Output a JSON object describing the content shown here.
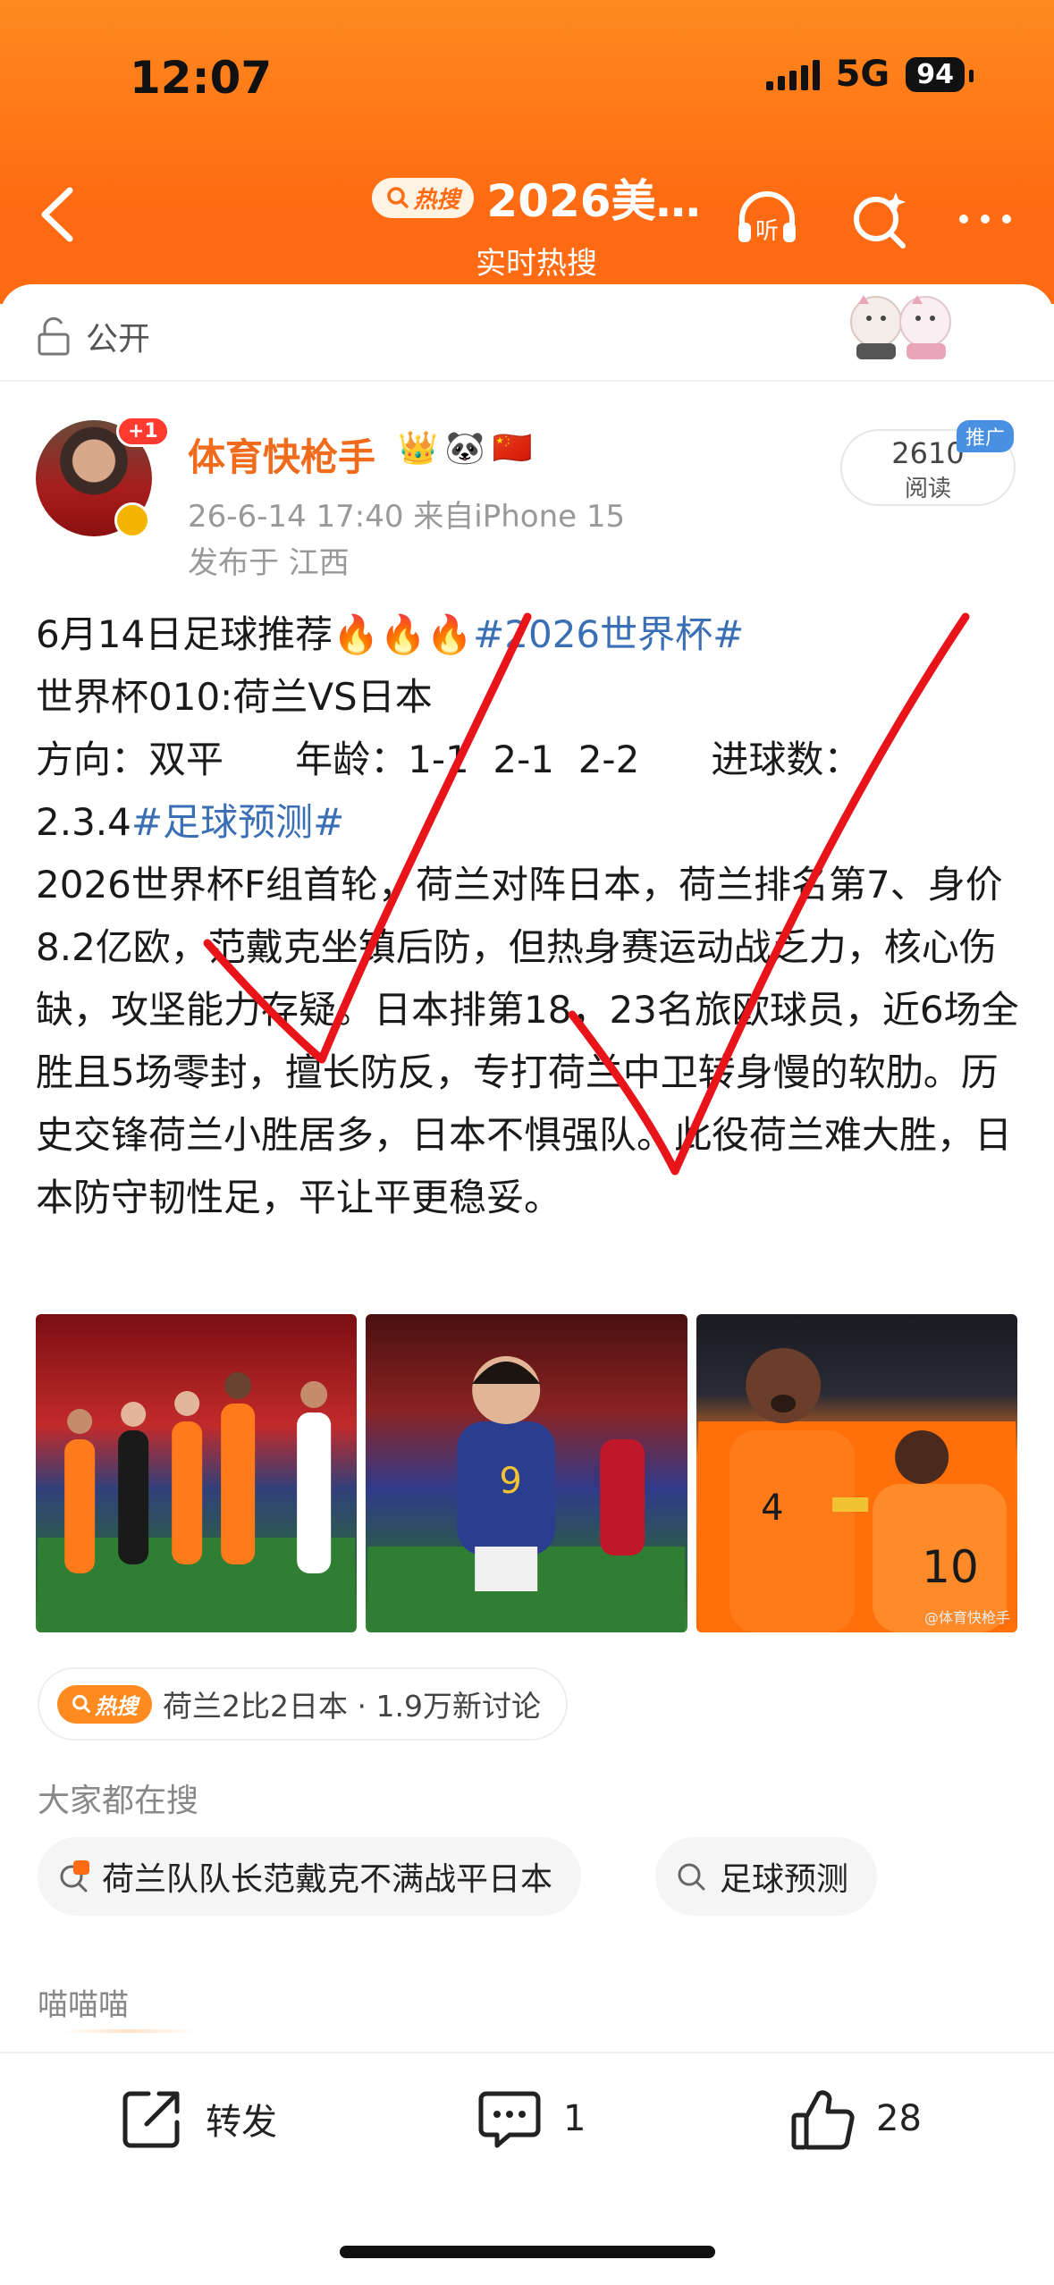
{
  "status_bar": {
    "time": "12:07",
    "network": "5G",
    "battery": "94"
  },
  "header": {
    "hot_tag": "热搜",
    "title": "2026美…",
    "subtitle": "实时热搜",
    "icons": [
      "back-icon",
      "listen-icon",
      "search-sparkle-icon",
      "more-icon"
    ],
    "listen_label": "听"
  },
  "visibility": {
    "label": "公开"
  },
  "post": {
    "author": "体育快枪手",
    "avatar_badge": "+1",
    "badges": [
      "👑",
      "🐼",
      "🇨🇳"
    ],
    "time_source": "26-6-14 17:40  来自iPhone 15",
    "location": "发布于 江西",
    "reads": "2610",
    "reads_label": "阅读",
    "promo": "推广",
    "line1": "6月14日足球推荐🔥🔥🔥",
    "line1_tag": "#2026世界杯#",
    "line2": "世界杯010:荷兰VS日本",
    "line3": "方向：双平      年龄：1-1  2-1  2-2      进球数：",
    "line4_prefix": "2.3.4",
    "line4_tag": "#足球预测#",
    "body": "2026世界杯F组首轮，荷兰对阵日本，荷兰排名第7、身价8.2亿欧，范戴克坐镇后防，但热身赛运动战乏力，核心伤缺，攻坚能力存疑。日本排第18，23名旅欧球员，近6场全胜且5场零封，擅长防反，专打荷兰中卫转身慢的软肋。历史交锋荷兰小胜居多，日本不惧强队。此役荷兰难大胜，日本防守韧性足，平让平更稳妥。",
    "photo_watermark": "@体育快枪手"
  },
  "hot_topic": {
    "tag": "热搜",
    "text": "荷兰2比2日本 · 1.9万新讨论"
  },
  "searches": {
    "label": "大家都在搜",
    "items": [
      "荷兰队队长范戴克不满战平日本",
      "足球预测"
    ]
  },
  "miao": "喵喵喵",
  "actions": {
    "share": "转发",
    "comments": "1",
    "likes": "28"
  },
  "colors": {
    "brand_orange": "#ff6a12",
    "username": "#f06b1b",
    "tag_blue": "#3a6fb5",
    "check_red": "#e8141a"
  }
}
